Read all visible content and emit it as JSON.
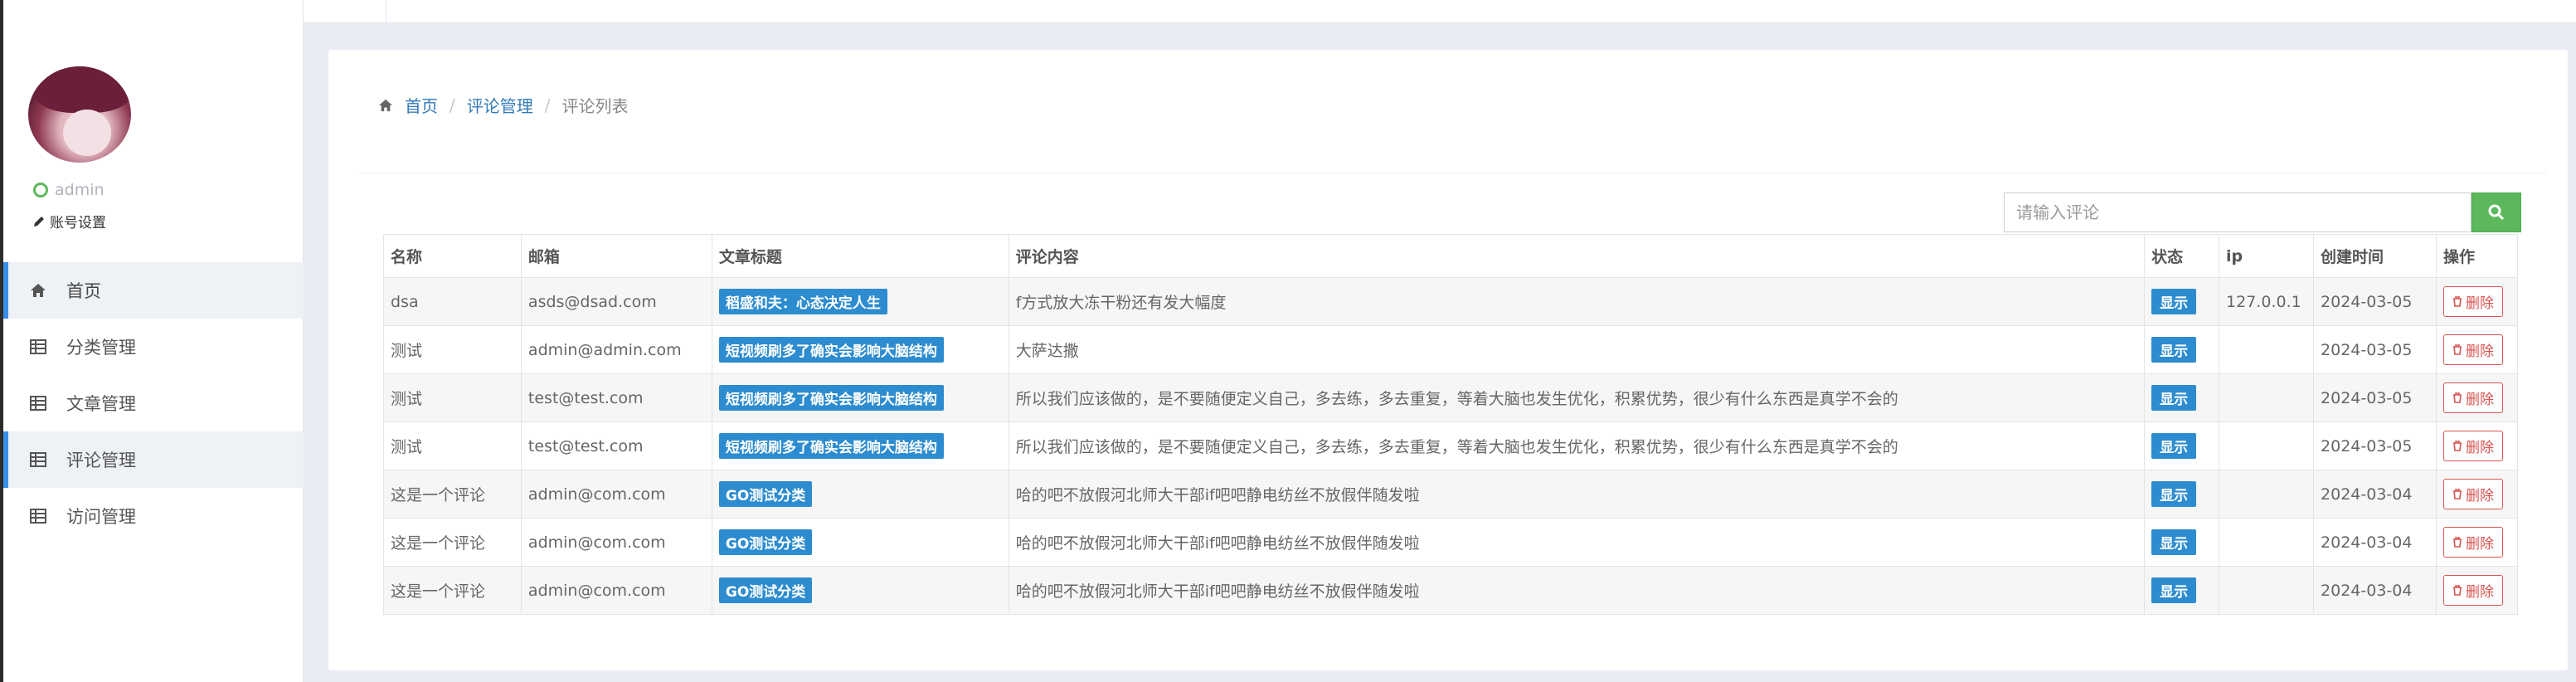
{
  "sidebar": {
    "username": "admin",
    "account_settings": "账号设置",
    "items": [
      {
        "label": "首页",
        "icon": "home-icon"
      },
      {
        "label": "分类管理",
        "icon": "table-icon"
      },
      {
        "label": "文章管理",
        "icon": "table-icon"
      },
      {
        "label": "评论管理",
        "icon": "table-icon"
      },
      {
        "label": "访问管理",
        "icon": "table-icon"
      }
    ]
  },
  "breadcrumb": {
    "home": "首页",
    "section": "评论管理",
    "current": "评论列表",
    "sep": "/"
  },
  "search": {
    "placeholder": "请输入评论"
  },
  "table": {
    "headers": [
      "名称",
      "邮箱",
      "文章标题",
      "评论内容",
      "状态",
      "ip",
      "创建时间",
      "操作"
    ],
    "rows": [
      {
        "name": "dsa",
        "email": "asds@dsad.com",
        "title": "稻盛和夫：心态决定人生",
        "content": "f方式放大冻干粉还有发大幅度",
        "status": "显示",
        "ip": "127.0.0.1",
        "date": "2024-03-05",
        "action": "删除"
      },
      {
        "name": "测试",
        "email": "admin@admin.com",
        "title": "短视频刷多了确实会影响大脑结构",
        "content": "大萨达撒",
        "status": "显示",
        "ip": "",
        "date": "2024-03-05",
        "action": "删除"
      },
      {
        "name": "测试",
        "email": "test@test.com",
        "title": "短视频刷多了确实会影响大脑结构",
        "content": "所以我们应该做的，是不要随便定义自己，多去练，多去重复，等着大脑也发生优化，积累优势，很少有什么东西是真学不会的",
        "status": "显示",
        "ip": "",
        "date": "2024-03-05",
        "action": "删除"
      },
      {
        "name": "测试",
        "email": "test@test.com",
        "title": "短视频刷多了确实会影响大脑结构",
        "content": "所以我们应该做的，是不要随便定义自己，多去练，多去重复，等着大脑也发生优化，积累优势，很少有什么东西是真学不会的",
        "status": "显示",
        "ip": "",
        "date": "2024-03-05",
        "action": "删除"
      },
      {
        "name": "这是一个评论",
        "email": "admin@com.com",
        "title": "GO测试分类",
        "content": "哈的吧不放假河北师大干部if吧吧静电纺丝不放假伴随发啦",
        "status": "显示",
        "ip": "",
        "date": "2024-03-04",
        "action": "删除"
      },
      {
        "name": "这是一个评论",
        "email": "admin@com.com",
        "title": "GO测试分类",
        "content": "哈的吧不放假河北师大干部if吧吧静电纺丝不放假伴随发啦",
        "status": "显示",
        "ip": "",
        "date": "2024-03-04",
        "action": "删除"
      },
      {
        "name": "这是一个评论",
        "email": "admin@com.com",
        "title": "GO测试分类",
        "content": "哈的吧不放假河北师大干部if吧吧静电纺丝不放假伴随发啦",
        "status": "显示",
        "ip": "",
        "date": "2024-03-04",
        "action": "删除"
      }
    ]
  },
  "colors": {
    "accent": "#2d8ccf",
    "success": "#5cb85c",
    "danger": "#d9534f",
    "link": "#337ab7"
  }
}
